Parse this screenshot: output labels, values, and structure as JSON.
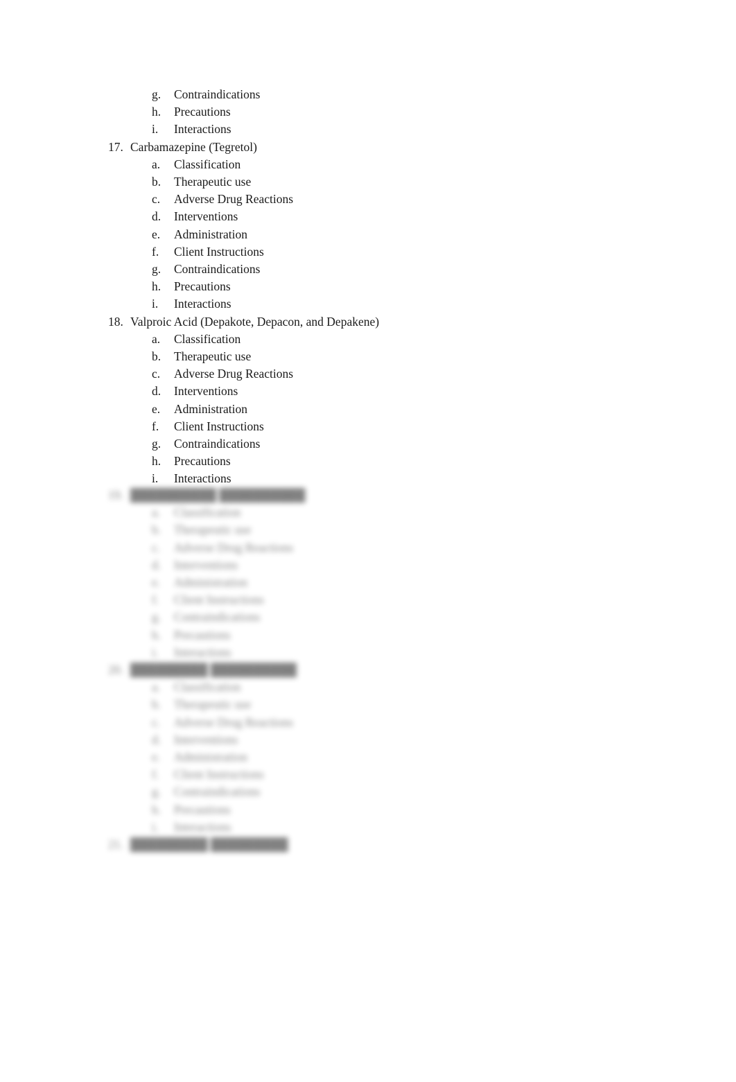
{
  "document": {
    "continued_items": [
      {
        "marker": "g.",
        "label": "Contraindications"
      },
      {
        "marker": "h.",
        "label": "Precautions"
      },
      {
        "marker": "i.",
        "label": "Interactions"
      }
    ],
    "sections": [
      {
        "number": "17.",
        "title": "Carbamazepine (Tegretol)",
        "items": [
          {
            "marker": "a.",
            "label": "Classification"
          },
          {
            "marker": "b.",
            "label": "Therapeutic use"
          },
          {
            "marker": "c.",
            "label": "Adverse Drug Reactions"
          },
          {
            "marker": "d.",
            "label": "Interventions"
          },
          {
            "marker": "e.",
            "label": "Administration"
          },
          {
            "marker": "f.",
            "label": "Client Instructions"
          },
          {
            "marker": "g.",
            "label": "Contraindications"
          },
          {
            "marker": "h.",
            "label": "Precautions"
          },
          {
            "marker": "i.",
            "label": "Interactions"
          }
        ]
      },
      {
        "number": "18.",
        "title": "Valproic Acid (Depakote, Depacon, and Depakene)",
        "items": [
          {
            "marker": "a.",
            "label": "Classification"
          },
          {
            "marker": "b.",
            "label": "Therapeutic use"
          },
          {
            "marker": "c.",
            "label": "Adverse Drug Reactions"
          },
          {
            "marker": "d.",
            "label": "Interventions"
          },
          {
            "marker": "e.",
            "label": "Administration"
          },
          {
            "marker": "f.",
            "label": "Client Instructions"
          },
          {
            "marker": "g.",
            "label": "Contraindications"
          },
          {
            "marker": "h.",
            "label": "Precautions"
          },
          {
            "marker": "i.",
            "label": "Interactions"
          }
        ]
      }
    ],
    "blurred_preview": {
      "sections": [
        {
          "number": "19.",
          "title": "██████████ ██████████",
          "items": [
            "a.",
            "b.",
            "c.",
            "d.",
            "e.",
            "f.",
            "g.",
            "h.",
            "i."
          ]
        },
        {
          "number": "20.",
          "title": "█████████ ██████████",
          "items": [
            "a.",
            "b.",
            "c.",
            "d.",
            "e.",
            "f.",
            "g.",
            "h.",
            "i."
          ]
        },
        {
          "number": "21.",
          "title": "█████████ █████████",
          "items": []
        }
      ],
      "item_labels": [
        "Classification",
        "Therapeutic use",
        "Adverse Drug Reactions",
        "Interventions",
        "Administration",
        "Client Instructions",
        "Contraindications",
        "Precautions",
        "Interactions"
      ]
    }
  }
}
